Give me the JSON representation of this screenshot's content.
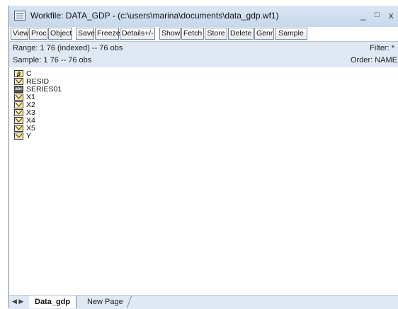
{
  "window": {
    "title": "Workfile: DATA_GDP - (c:\\users\\marina\\documents\\data_gdp.wf1)",
    "minimize": "_",
    "maximize": "□",
    "close": "x"
  },
  "toolbar": {
    "buttons": [
      "View",
      "Proc",
      "Object",
      "Save",
      "Freeze",
      "Details+/-",
      "Show",
      "Fetch",
      "Store",
      "Delete",
      "Genr",
      "Sample"
    ]
  },
  "info": {
    "range": "Range:  1 76 (indexed)  --  76 obs",
    "sample": "Sample: 1 76  --  76 obs",
    "filter": "Filter: *",
    "order": "Order: NAME"
  },
  "objects": [
    {
      "name": "C",
      "icon": "coefficient-icon"
    },
    {
      "name": "RESID",
      "icon": "series-icon"
    },
    {
      "name": "SERIES01",
      "icon": "alpha-series-icon"
    },
    {
      "name": "X1",
      "icon": "series-icon"
    },
    {
      "name": "X2",
      "icon": "series-icon"
    },
    {
      "name": "X3",
      "icon": "series-icon"
    },
    {
      "name": "X4",
      "icon": "series-icon"
    },
    {
      "name": "X5",
      "icon": "series-icon"
    },
    {
      "name": "Y",
      "icon": "series-icon"
    }
  ],
  "tabs": {
    "active": "Data_gdp",
    "new_page": "New Page"
  }
}
